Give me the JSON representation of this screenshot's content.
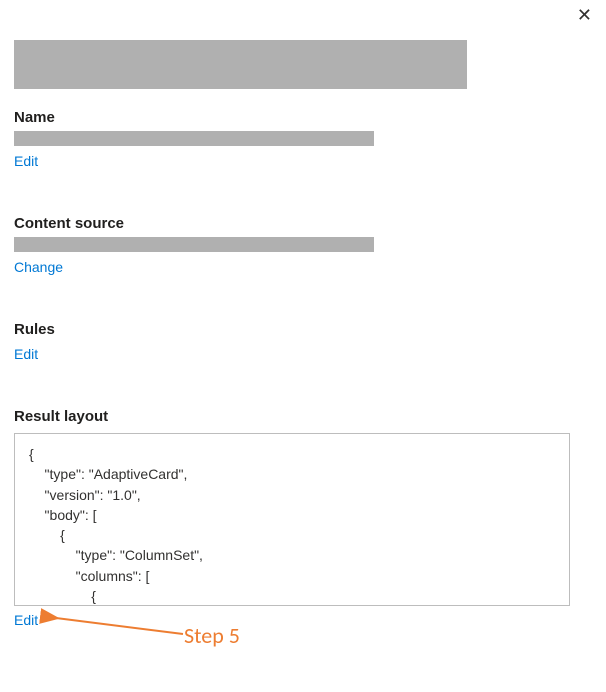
{
  "labels": {
    "name": "Name",
    "content_source": "Content source",
    "rules": "Rules",
    "result_layout": "Result layout"
  },
  "actions": {
    "edit_name": "Edit",
    "change_source": "Change",
    "edit_rules": "Edit",
    "edit_layout": "Edit"
  },
  "result_layout_json": "{\n    \"type\": \"AdaptiveCard\",\n    \"version\": \"1.0\",\n    \"body\": [\n        {\n            \"type\": \"ColumnSet\",\n            \"columns\": [\n                {\n                    \"type\": \"Column\",\n                    \"width\": \"auto\",",
  "annotation": {
    "label": "Step 5"
  },
  "colors": {
    "link": "#0078d4",
    "placeholder": "#b0b0b0",
    "annotation": "#ed7d31"
  }
}
